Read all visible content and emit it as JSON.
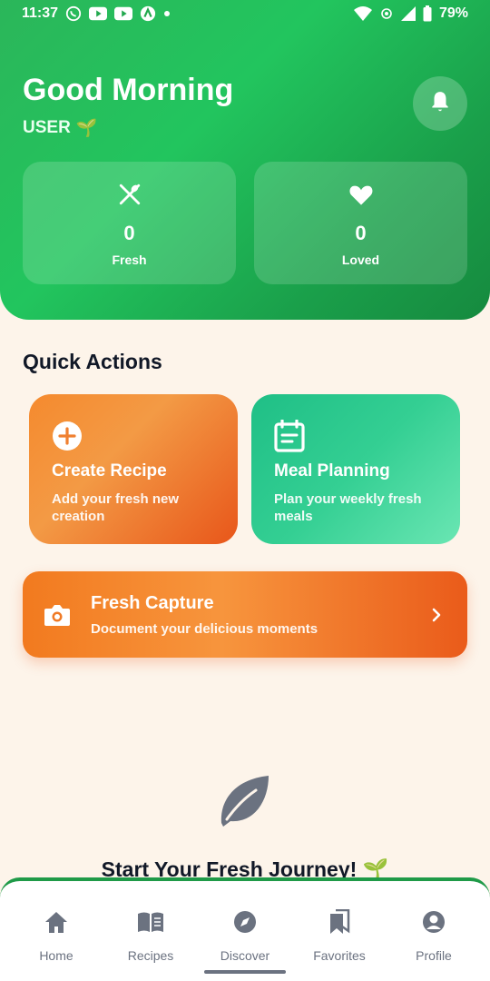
{
  "status_bar": {
    "time": "11:37",
    "battery": "79%"
  },
  "header": {
    "greeting": "Good Morning",
    "username": "USER",
    "username_emoji": "🌱",
    "bell_icon": "bell-icon"
  },
  "stats": [
    {
      "icon": "fork-knife-icon",
      "value": "0",
      "label": "Fresh"
    },
    {
      "icon": "heart-icon",
      "value": "0",
      "label": "Loved"
    }
  ],
  "quick_actions": {
    "title": "Quick Actions",
    "items": [
      {
        "icon": "plus-circle-icon",
        "title": "Create Recipe",
        "desc_line1": "Add your fresh new",
        "desc_line2": "creation"
      },
      {
        "icon": "calendar-icon",
        "title": "Meal Planning",
        "desc_line1": "Plan your weekly fresh",
        "desc_line2": "meals"
      }
    ]
  },
  "capture": {
    "icon": "camera-icon",
    "title": "Fresh Capture",
    "desc": "Document your delicious moments",
    "chevron": "chevron-right-icon"
  },
  "empty_state": {
    "icon": "leaf-icon",
    "title": "Start Your Fresh Journey! 🌱"
  },
  "bottom_nav": [
    {
      "icon": "home-icon",
      "label": "Home"
    },
    {
      "icon": "book-icon",
      "label": "Recipes"
    },
    {
      "icon": "compass-icon",
      "label": "Discover"
    },
    {
      "icon": "bookmarks-icon",
      "label": "Favorites"
    },
    {
      "icon": "user-circle-icon",
      "label": "Profile"
    }
  ],
  "colors": {
    "green": "#22c55e",
    "orange": "#f27a1f",
    "teal": "#1fbf86",
    "cream": "#fdf4ea"
  }
}
